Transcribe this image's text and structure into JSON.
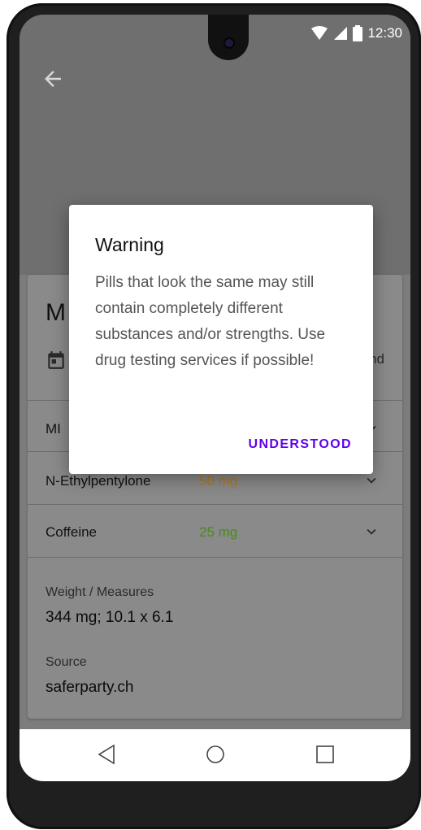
{
  "status_bar": {
    "time": "12:30",
    "icons": [
      "wifi-icon",
      "signal-icon",
      "battery-icon"
    ]
  },
  "header": {
    "back_icon": "arrow-back-icon"
  },
  "card": {
    "title_partial": "M",
    "date_partial": "nd",
    "substances": [
      {
        "name": "MI",
        "dose": "",
        "dose_color": "#b06a1a"
      },
      {
        "name": "N-Ethylpentylone",
        "dose": "50 mg",
        "dose_color": "#b07a20"
      },
      {
        "name": "Coffeine",
        "dose": "25 mg",
        "dose_color": "#4a8a1a"
      }
    ],
    "weight_label": "Weight / Measures",
    "weight_value": "344 mg; 10.1 x 6.1",
    "source_label": "Source",
    "source_value": "saferparty.ch"
  },
  "dialog": {
    "title": "Warning",
    "message": "Pills that look the same may still contain completely different substances and/or strengths. Use drug testing services if possible!",
    "action_label": "UNDERSTOOD",
    "action_color": "#6200ee"
  },
  "nav_bar": {
    "icons": [
      "back-triangle-icon",
      "home-circle-icon",
      "recents-square-icon"
    ]
  }
}
